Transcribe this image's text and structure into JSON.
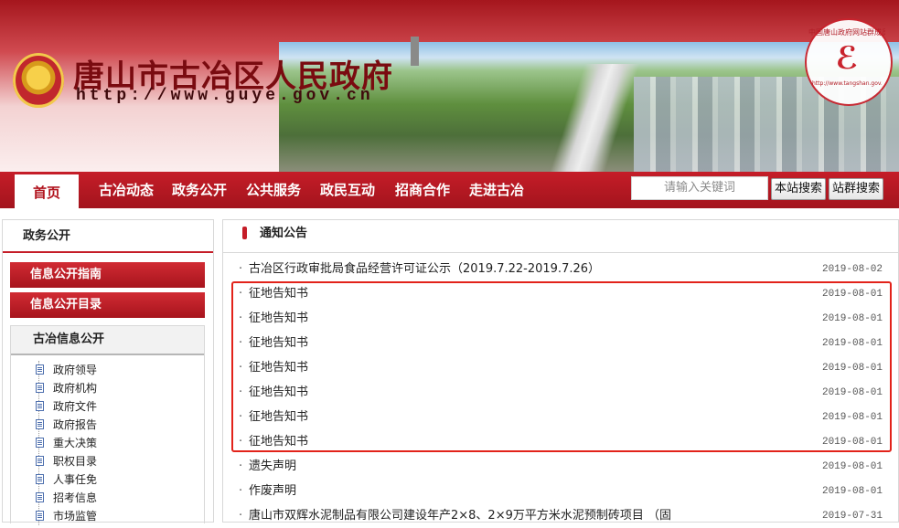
{
  "header": {
    "title": "唐山市古冶区人民政府",
    "url": "http://www.guye.gov.cn",
    "seal_text": "中国唐山政府网站群成员",
    "seal_sub": "http://www.tangshan.gov.cn"
  },
  "nav": {
    "home": "首页",
    "items": [
      "古冶动态",
      "政务公开",
      "公共服务",
      "政民互动",
      "招商合作",
      "走进古冶"
    ]
  },
  "search": {
    "placeholder": "请输入关键词",
    "site_btn": "本站搜索",
    "group_btn": "站群搜索"
  },
  "sidebar": {
    "section_title": "政务公开",
    "buttons": [
      "信息公开指南",
      "信息公开目录"
    ],
    "subpanel_title": "古冶信息公开",
    "tree": [
      "政府领导",
      "政府机构",
      "政府文件",
      "政府报告",
      "重大决策",
      "职权目录",
      "人事任免",
      "招考信息",
      "市场监管"
    ]
  },
  "notice": {
    "title": "通知公告",
    "items": [
      {
        "text": "古冶区行政审批局食品经营许可证公示（2019.7.22-2019.7.26）",
        "date": "2019-08-02"
      },
      {
        "text": "征地告知书",
        "date": "2019-08-01"
      },
      {
        "text": "征地告知书",
        "date": "2019-08-01"
      },
      {
        "text": "征地告知书",
        "date": "2019-08-01"
      },
      {
        "text": "征地告知书",
        "date": "2019-08-01"
      },
      {
        "text": "征地告知书",
        "date": "2019-08-01"
      },
      {
        "text": "征地告知书",
        "date": "2019-08-01"
      },
      {
        "text": "征地告知书",
        "date": "2019-08-01"
      },
      {
        "text": "遗失声明",
        "date": "2019-08-01"
      },
      {
        "text": "作废声明",
        "date": "2019-08-01"
      },
      {
        "text": "唐山市双辉水泥制品有限公司建设年产2×8、2×9万平方米水泥预制砖项目 （固",
        "date": "2019-07-31"
      }
    ]
  },
  "colors": {
    "brand_red": "#c51d28",
    "highlight_red": "#e2231a"
  }
}
